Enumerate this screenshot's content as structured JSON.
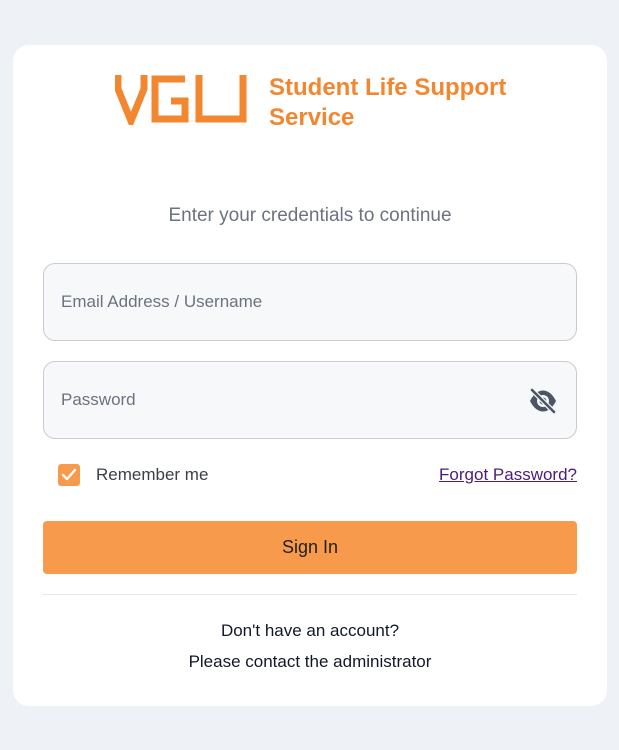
{
  "brand": {
    "logo_mark": "VGU",
    "title_line1": "Student Life Support",
    "title_line2": "Service",
    "accent_color": "#f3872f"
  },
  "subtitle": "Enter your credentials to continue",
  "form": {
    "email_placeholder": "Email Address / Username",
    "password_placeholder": "Password",
    "password_toggle_icon": "eye-off-icon",
    "remember_label": "Remember me",
    "remember_checked": true,
    "forgot_label": "Forgot Password?",
    "submit_label": "Sign In",
    "button_color": "#f79a4c"
  },
  "footer": {
    "line1": "Don't have an account?",
    "line2": "Please contact the administrator"
  }
}
